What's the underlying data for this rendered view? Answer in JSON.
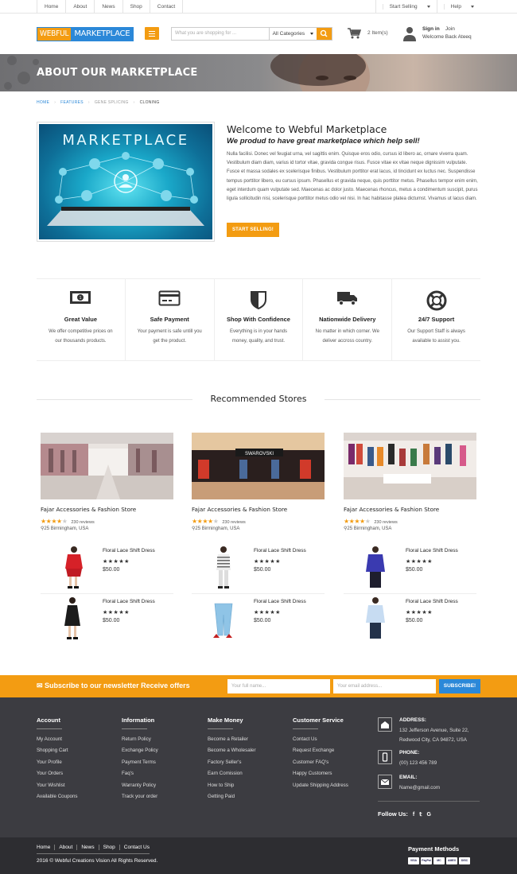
{
  "topbar": {
    "links": [
      "Home",
      "About",
      "News",
      "Shop",
      "Contact"
    ],
    "start_selling": "Start Selling",
    "help": "Help"
  },
  "header": {
    "logo_part1": "WEBFUL",
    "logo_part2": "MARKETPLACE",
    "search_placeholder": "What you are shopping for ...",
    "category": "All Categories",
    "cart_count": "2 Item(s)",
    "sign_in": "Sign in",
    "join": "Join",
    "welcome_back": "Welcome Back Ateeq"
  },
  "banner": {
    "title": "ABOUT OUR MARKETPLACE"
  },
  "breadcrumb": [
    "HOME",
    "FEATURES",
    "GENE SPLICING",
    "CLONING"
  ],
  "welcome": {
    "image_text": "MARKETPLACE",
    "title": "Welcome to Webful Marketplace",
    "subtitle": "We produd to have great marketplace which help sell!",
    "body": "Nulla facilisi. Donec vel feugiat urna, vel sagittis enim. Quisque eros odio, cursus id libero ac, ornare viverra quam. Vestibulum diam diam, varius id tortor vitae, gravida congue risus. Fusce vitae ex vitae neque dignissim vulputate. Fusce et massa sodales ex scelerisque finibus. Vestibulum porttitor erat lacus, id tincidunt ex luctus nec. Suspendisse tempus porttitor libero, eu cursus ipsum. Phasellus et gravida neque, quis porttitor metus. Phasellus tempor enim enim, eget interdum quam vulputate sed. Maecenas ac dolor justo. Maecenas rhoncus, metus a condimentum suscipit, purus ligula sollicitudin nisi, scelerisque porttitor metus odio vel nisi. In hac habitasse platea dictumst. Vivamus ut lacus diam.",
    "button": "START SELLING!"
  },
  "features": [
    {
      "title": "Great Value",
      "desc": "We offer competitive prices on our thousands products.",
      "icon": "money-icon"
    },
    {
      "title": "Safe Payment",
      "desc": "Your payment is safe untill you get the product.",
      "icon": "credit-card-icon"
    },
    {
      "title": "Shop With Confidence",
      "desc": "Everything is in your hands money, quality, and trust.",
      "icon": "shield-icon"
    },
    {
      "title": "Nationwide Delivery",
      "desc": "No matter in which corner. We deliver accross country.",
      "icon": "truck-icon"
    },
    {
      "title": "24/7 Support",
      "desc": "Our Support Staff is always available to assist you.",
      "icon": "lifebuoy-icon"
    }
  ],
  "recommended": {
    "heading": "Recommended Stores",
    "stores": [
      {
        "name": "Fajar Accessories & Fashion Store",
        "rating": 4,
        "reviews": "230 reviews",
        "location": "25 Birmingham, USA",
        "products": [
          {
            "name": "Floral Lace Shift Dress",
            "price": "$50.00"
          },
          {
            "name": "Floral Lace Shift Dress",
            "price": "$50.00"
          }
        ]
      },
      {
        "name": "Fajar Accessories & Fashion Store",
        "rating": 4,
        "reviews": "230 reviews",
        "location": "25 Birmingham, USA",
        "products": [
          {
            "name": "Floral Lace Shift Dress",
            "price": "$50.00"
          },
          {
            "name": "Floral Lace Shift Dress",
            "price": "$50.00"
          }
        ]
      },
      {
        "name": "Fajar Accessories & Fashion Store",
        "rating": 4,
        "reviews": "230 reviews",
        "location": "25 Birmingham, USA",
        "products": [
          {
            "name": "Floral Lace Shift Dress",
            "price": "$50.00"
          },
          {
            "name": "Floral Lace Shift Dress",
            "price": "$50.00"
          }
        ]
      }
    ]
  },
  "newsletter": {
    "title": "Subscribe to our newsletter Receive offers",
    "name_placeholder": "Your full name...",
    "email_placeholder": "Your email address...",
    "button": "SUBSCRIBE!"
  },
  "footer": {
    "columns": [
      {
        "title": "Account",
        "items": [
          "My Account",
          "Shopping Cart",
          "Your Profile",
          "Your Orders",
          "Your Wishlist",
          "Available Coupons"
        ]
      },
      {
        "title": "Information",
        "items": [
          "Return Policy",
          "Exchange Policy",
          "Payment Terms",
          "Faq's",
          "Warranty Policy",
          "Track your order"
        ]
      },
      {
        "title": "Make Money",
        "items": [
          "Become a Retailer",
          "Become a Wholesaler",
          "Factory Seller's",
          "Earn Comission",
          "How to Ship",
          "Getting Paid"
        ]
      },
      {
        "title": "Customer Service",
        "items": [
          "Contact Us",
          "Request Exchange",
          "Customer FAQ's",
          "Happy Customers",
          "Update Shipping Address"
        ]
      }
    ],
    "address_label": "ADDRESS:",
    "address": "132 Jefferson Avenue, Suite 22, Redwood City, CA 94872, USA",
    "phone_label": "PHONE:",
    "phone": "(00) 123 456 789",
    "email_label": "EMAIL:",
    "email": "Name@gmail.com",
    "follow": "Follow Us:",
    "bottom_links": [
      "Home",
      "About",
      "News",
      "Shop",
      "Contact Us"
    ],
    "copyright": "2016 © Webful Creations Vision All Rights Reserved.",
    "payment_methods": "Payment Methods",
    "cards": [
      "VISA",
      "PayPal",
      "MC",
      "AMEX",
      "DISC"
    ]
  },
  "colors": {
    "accent": "#f39c12",
    "brand_blue": "#2b88d8",
    "footer": "#3c3c41"
  }
}
